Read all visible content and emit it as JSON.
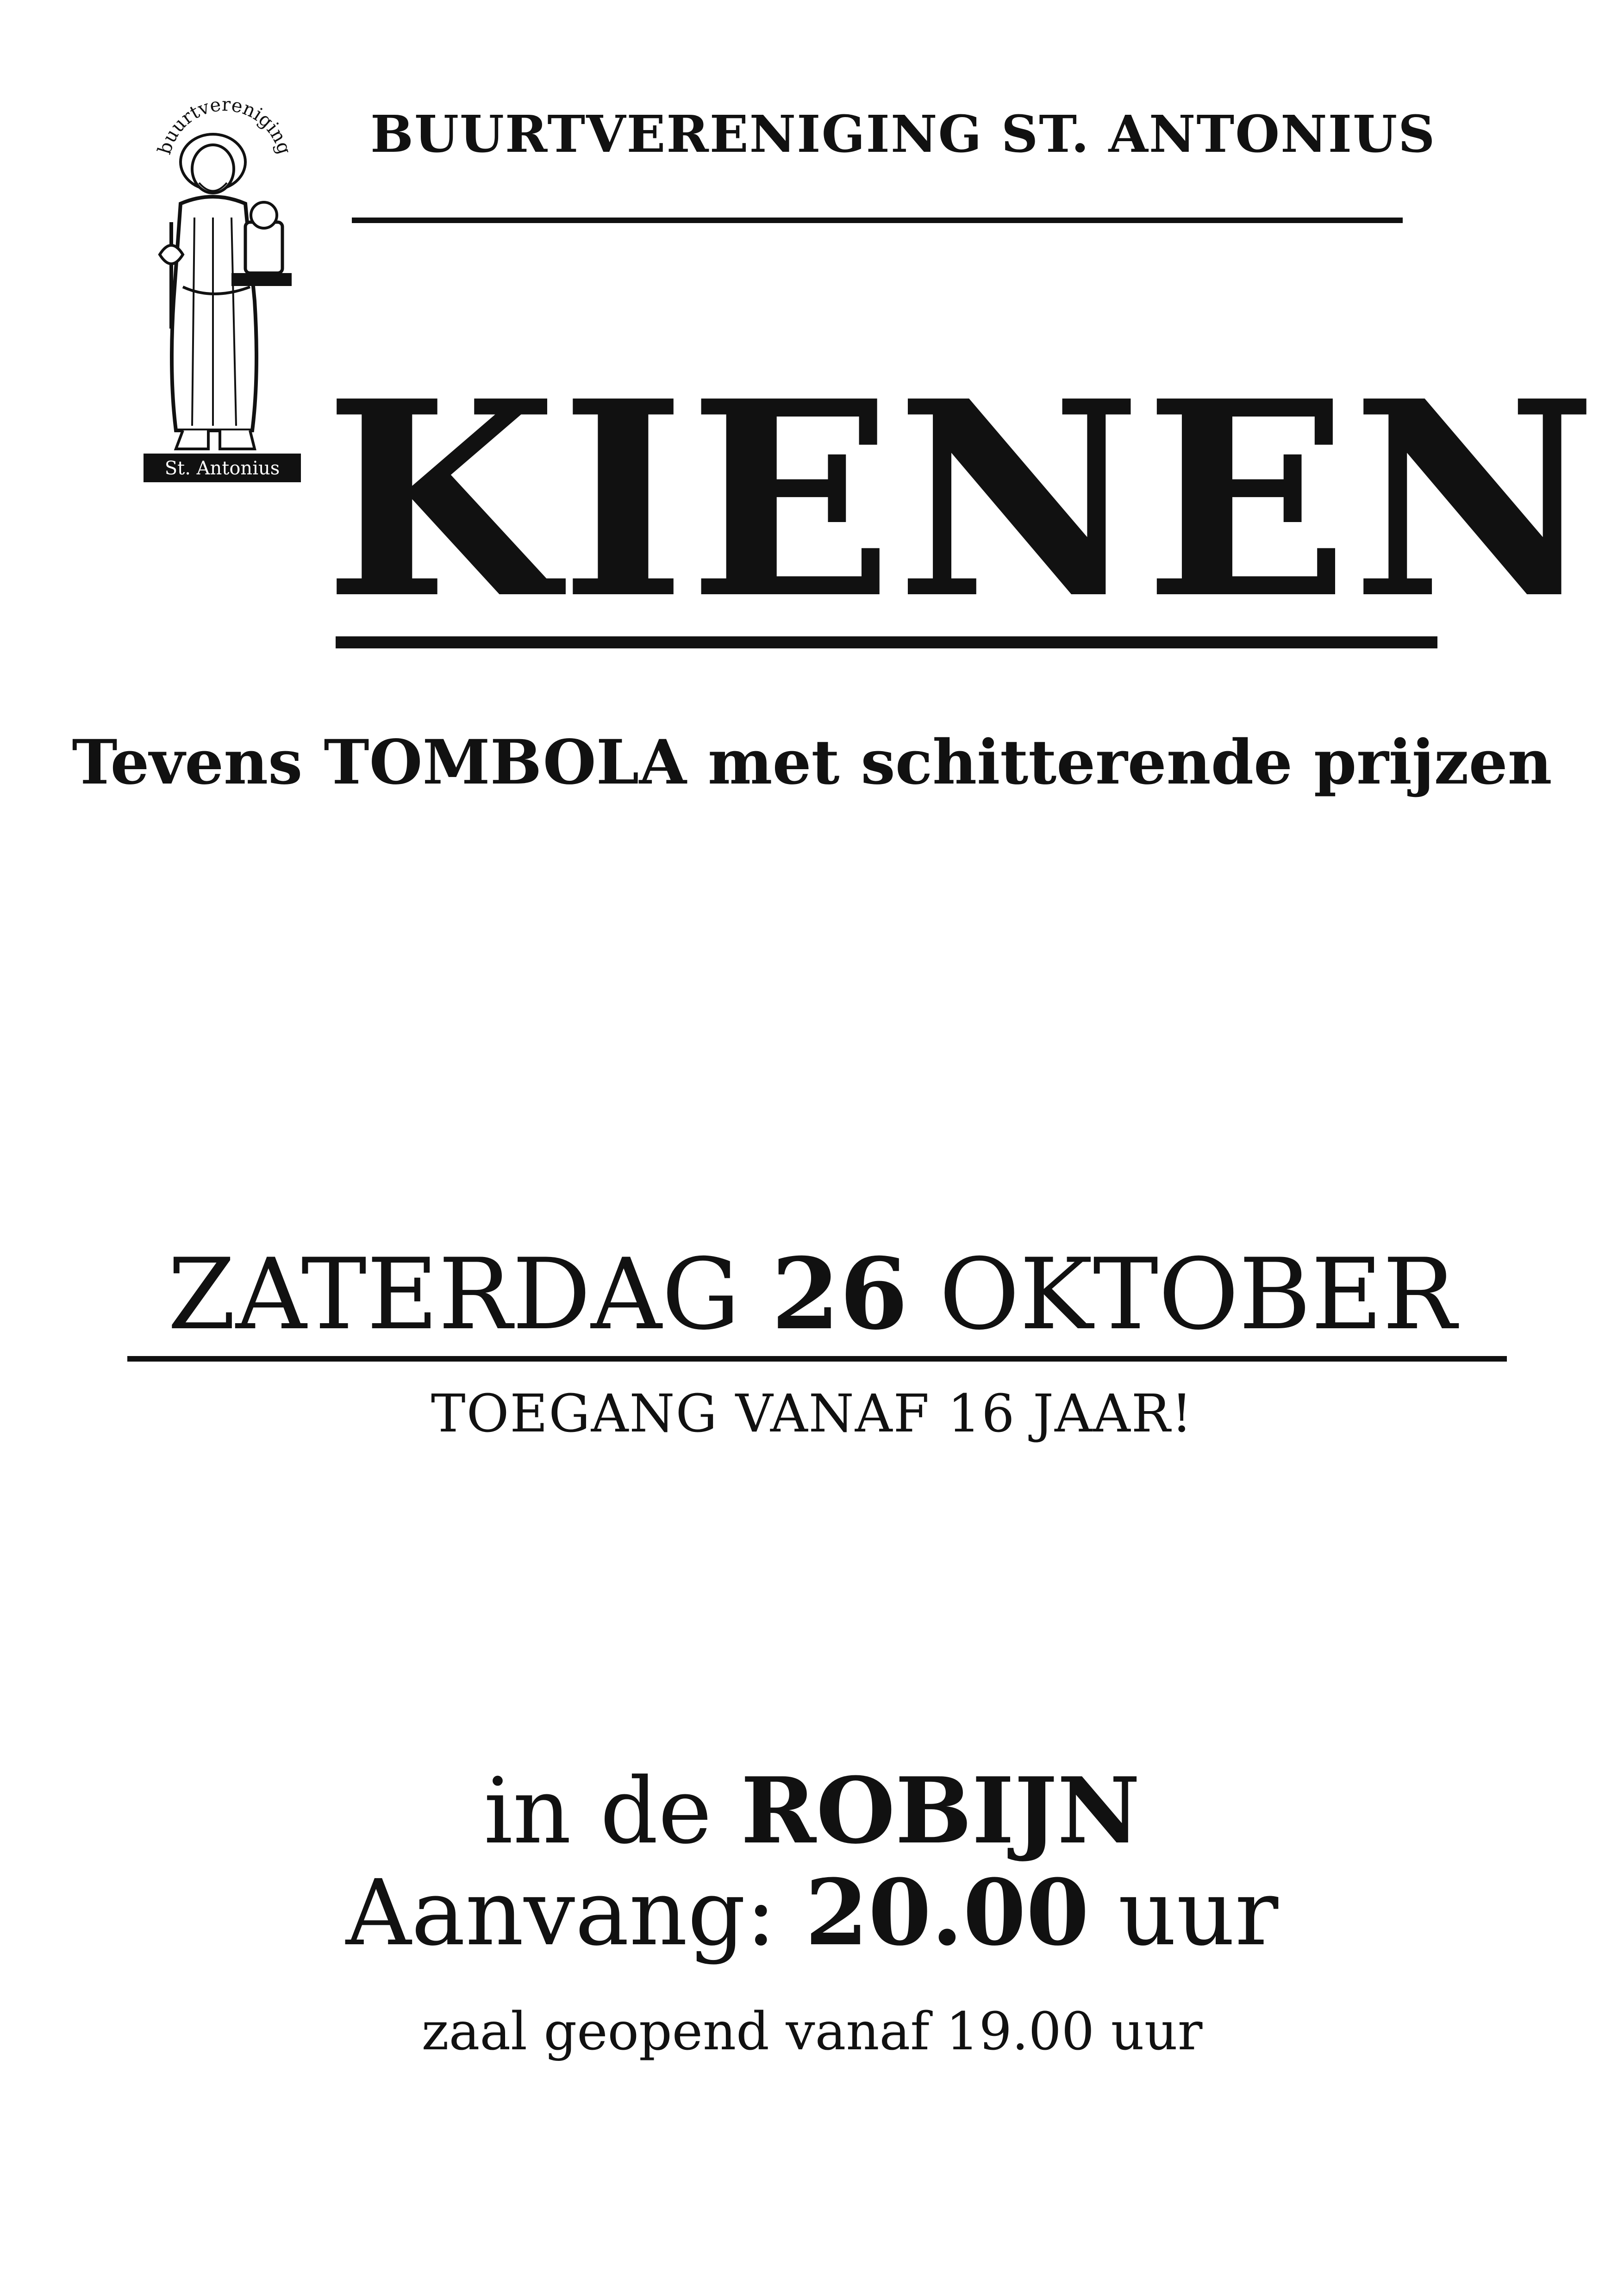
{
  "logo": {
    "arc_text": "buurtvereniging",
    "banner_text": "St. Antonius",
    "icon": "saint-antonius-figure"
  },
  "header": {
    "organization": "BUURTVERENIGING ST. ANTONIUS"
  },
  "main": {
    "title": "KIENEN",
    "subtitle": "Tevens TOMBOLA met schitterende prijzen"
  },
  "event": {
    "date_day": "ZATERDAG",
    "date_number": "26",
    "date_month": "OKTOBER",
    "age_notice": "TOEGANG VANAF 16 JAAR!"
  },
  "venue": {
    "prefix": "in de",
    "name": "ROBIJN",
    "start_label": "Aanvang:",
    "start_time": "20.00",
    "start_unit": "uur",
    "doors_note": "zaal geopend vanaf 19.00 uur"
  }
}
